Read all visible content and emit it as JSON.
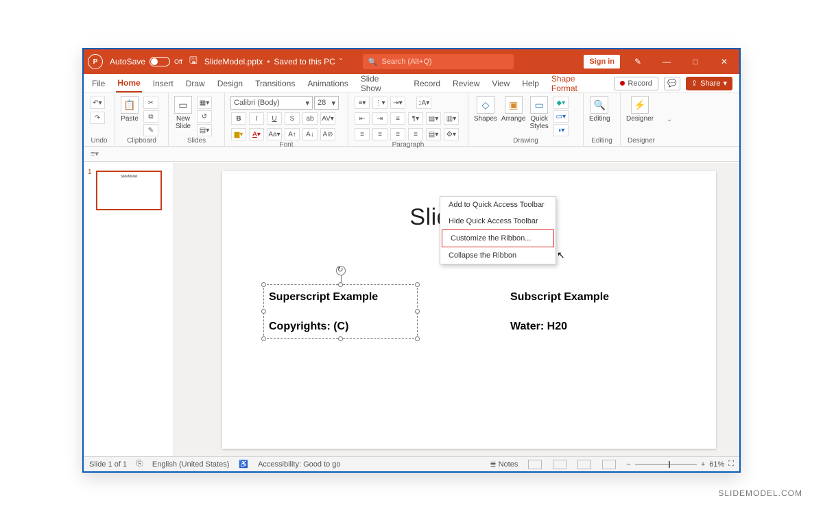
{
  "titlebar": {
    "autosave_label": "AutoSave",
    "autosave_state": "Off",
    "filename": "SlideModel.pptx",
    "saved_status": "Saved to this PC",
    "search_placeholder": "Search (Alt+Q)",
    "signin": "Sign in"
  },
  "tabs": {
    "file": "File",
    "home": "Home",
    "insert": "Insert",
    "draw": "Draw",
    "design": "Design",
    "transitions": "Transitions",
    "animations": "Animations",
    "slideshow": "Slide Show",
    "record": "Record",
    "review": "Review",
    "view": "View",
    "help": "Help",
    "shapeformat": "Shape Format"
  },
  "tabs_right": {
    "record": "Record",
    "share": "Share"
  },
  "ribbon": {
    "undo": "Undo",
    "clipboard": {
      "label": "Clipboard",
      "paste": "Paste"
    },
    "slides": {
      "label": "Slides",
      "newslide": "New\nSlide"
    },
    "font": {
      "label": "Font",
      "name": "Calibri (Body)",
      "size": "28"
    },
    "paragraph": {
      "label": "Paragraph"
    },
    "drawing": {
      "label": "Drawing",
      "shapes": "Shapes",
      "arrange": "Arrange",
      "quick": "Quick\nStyles"
    },
    "editing": {
      "label": "Editing",
      "btn": "Editing"
    },
    "designer": {
      "label": "Designer",
      "btn": "Designer"
    }
  },
  "context_menu": {
    "add_qat": "Add to Quick Access Toolbar",
    "hide_qat": "Hide Quick Access Toolbar",
    "customize": "Customize the Ribbon...",
    "collapse": "Collapse the Ribbon"
  },
  "thumbnail": {
    "number": "1"
  },
  "slide": {
    "title": "SlideModel",
    "left_heading": "Superscript Example",
    "left_body": "Copyrights: (C)",
    "right_heading": "Subscript Example",
    "right_body": "Water: H20"
  },
  "status": {
    "slide": "Slide 1 of 1",
    "lang": "English (United States)",
    "a11y": "Accessibility: Good to go",
    "notes": "Notes",
    "zoom": "61%"
  },
  "watermark": "SLIDEMODEL.COM"
}
